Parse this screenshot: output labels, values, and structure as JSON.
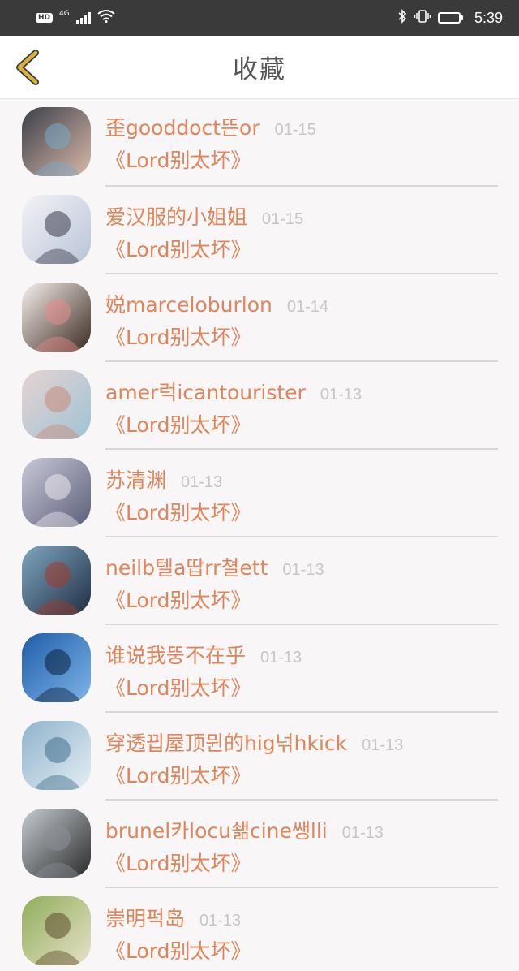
{
  "status_bar": {
    "hd": "HD",
    "network": "4G",
    "time": "5:39",
    "battery_level": 0.85
  },
  "nav": {
    "title": "收藏",
    "back_icon": "chevron-left-icon",
    "accent": "#d9b23c"
  },
  "colors": {
    "name": "#e0855a",
    "date": "#c6c6c6",
    "divider": "#d8d6d6"
  },
  "items": [
    {
      "name": "歪gooddoct뜬or",
      "date": "01-15",
      "book": "《Lord别太坏》",
      "avatar": [
        "#3b3f4a",
        "#d9b8a8",
        "#7aa9c7"
      ]
    },
    {
      "name": "爱汉服的小姐姐",
      "date": "01-15",
      "book": "《Lord别太坏》",
      "avatar": [
        "#f3f3f5",
        "#b9c4d9",
        "#3a3a4a"
      ]
    },
    {
      "name": "娧marceloburlon",
      "date": "01-14",
      "book": "《Lord别太坏》",
      "avatar": [
        "#f7f1ec",
        "#3b2a22",
        "#e88a8a"
      ]
    },
    {
      "name": "amer럭icantourister",
      "date": "01-13",
      "book": "《Lord别太坏》",
      "avatar": [
        "#e7d3d0",
        "#9fc3d6",
        "#c98a7a"
      ]
    },
    {
      "name": "苏清渊",
      "date": "01-13",
      "book": "《Lord别太坏》",
      "avatar": [
        "#c9c8d8",
        "#5b5f7a",
        "#efe9ef"
      ]
    },
    {
      "name": "neilb텔a땁rr쳘ett",
      "date": "01-13",
      "book": "《Lord别太坏》",
      "avatar": [
        "#7fa7c0",
        "#1f2f44",
        "#a33a2a"
      ]
    },
    {
      "name": "谁说我뚱不在乎",
      "date": "01-13",
      "book": "《Lord别太坏》",
      "avatar": [
        "#1e5da8",
        "#7fb4e8",
        "#0a1f3a"
      ]
    },
    {
      "name": "穿透끱屋顶뮌的hig넊hkick",
      "date": "01-13",
      "book": "《Lord别太坏》",
      "avatar": [
        "#8fb3cc",
        "#e4eef3",
        "#3f6f8c"
      ]
    },
    {
      "name": "brunel카locu쇎cine쌩lli",
      "date": "01-13",
      "book": "《Lord别太坏》",
      "avatar": [
        "#c6ccd2",
        "#2a2a2a",
        "#8a9098"
      ]
    },
    {
      "name": "崇明퍽岛",
      "date": "01-13",
      "book": "《Lord别太坏》",
      "avatar": [
        "#8fae5a",
        "#e8e1c8",
        "#5a4a2a"
      ]
    }
  ]
}
